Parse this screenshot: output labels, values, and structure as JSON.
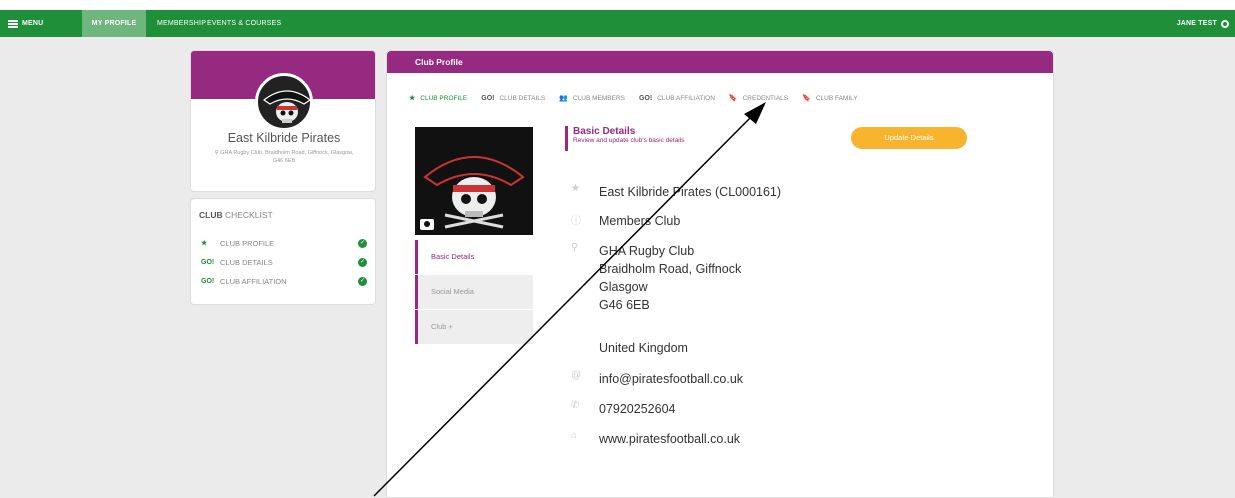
{
  "nav": {
    "menu": "MENU",
    "my_profile": "MY PROFILE",
    "membership": "MEMBERSHIP",
    "events": "EVENTS & COURSES",
    "user": "JANE TEST"
  },
  "profile": {
    "club_name": "East Kilbride Pirates",
    "address": "GHA Rugby Club, Braidholm Road, Giffnock, Glasgow, G46 6EB"
  },
  "checklist": {
    "title_bold": "CLUB",
    "title_rest": " CHECKLIST",
    "items": [
      {
        "icon": "★",
        "label": "CLUB PROFILE"
      },
      {
        "icon": "GO!",
        "label": "CLUB DETAILS"
      },
      {
        "icon": "GO!",
        "label": "CLUB AFFILIATION"
      }
    ]
  },
  "main": {
    "header": "Club Profile",
    "tabs": [
      {
        "icon": "★",
        "label": "CLUB PROFILE"
      },
      {
        "icon": "GO!",
        "label": "CLUB DETAILS"
      },
      {
        "icon": "👥",
        "label": "CLUB MEMBERS"
      },
      {
        "icon": "GO!",
        "label": "CLUB AFFILIATION"
      },
      {
        "icon": "🔖",
        "label": "CREDENTIALS"
      },
      {
        "icon": "🔖",
        "label": "CLUB FAMILY"
      }
    ],
    "side_nav": [
      "Basic Details",
      "Social Media",
      "Club +"
    ],
    "section_title": "Basic Details",
    "section_sub": "Review and update club's basic details",
    "update_button": "Update Details",
    "details": {
      "name": "East Kilbride Pirates (CL000161)",
      "type": "Members Club",
      "address_line1": "GHA Rugby Club",
      "address_line2": "Braidholm Road, Giffnock",
      "address_line3": "Glasgow",
      "address_line4": "G46 6EB",
      "country": "United Kingdom",
      "email": "info@piratesfootball.co.uk",
      "phone": "07920252604",
      "website": "www.piratesfootball.co.uk"
    }
  },
  "colors": {
    "nav_green": "#1f8f3a",
    "brand_purple": "#952a80",
    "accent_orange": "#f7b42c"
  }
}
